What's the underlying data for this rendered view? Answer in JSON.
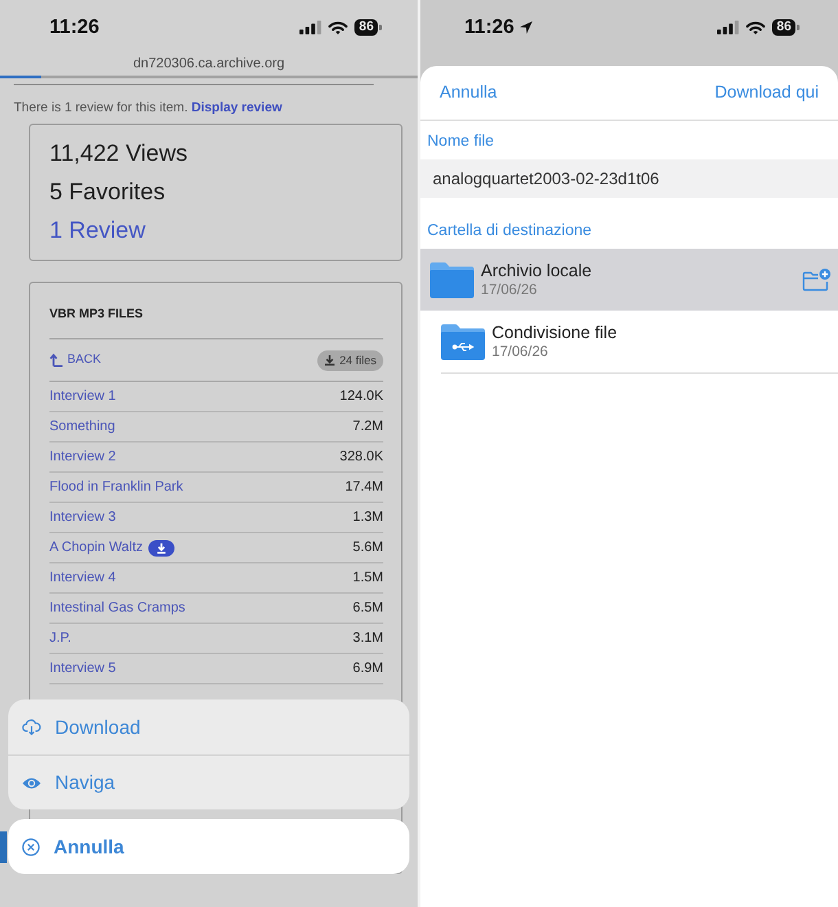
{
  "left_screen": {
    "status_bar": {
      "time": "11:26",
      "location": false,
      "battery": "86"
    },
    "address_bar": {
      "url": "dn720306.ca.archive.org",
      "level": 0.1
    },
    "review_notice": {
      "text": "There is 1 review for this item.",
      "link": "Display review"
    },
    "stats": {
      "views": "11,422 Views",
      "favorites": "5 Favorites",
      "reviews": "1 Review"
    },
    "files": {
      "title": "VBR MP3 FILES",
      "back": "BACK",
      "count": "24 files",
      "rows": [
        {
          "name": "Interview 1",
          "size": "124.0K",
          "download_badge": false
        },
        {
          "name": "Something",
          "size": "7.2M",
          "download_badge": false
        },
        {
          "name": "Interview 2",
          "size": "328.0K",
          "download_badge": false
        },
        {
          "name": "Flood in Franklin Park",
          "size": "17.4M",
          "download_badge": false
        },
        {
          "name": "Interview 3",
          "size": "1.3M",
          "download_badge": false
        },
        {
          "name": "A Chopin Waltz",
          "size": "5.6M",
          "download_badge": true
        },
        {
          "name": "Interview 4",
          "size": "1.5M",
          "download_badge": false
        },
        {
          "name": "Intestinal Gas Cramps",
          "size": "6.5M",
          "download_badge": false
        },
        {
          "name": "J.P.",
          "size": "3.1M",
          "download_badge": false
        },
        {
          "name": "Interview 5",
          "size": "6.9M",
          "download_badge": false
        }
      ]
    },
    "action_sheet": {
      "items": [
        {
          "kind": "download",
          "label": "Download"
        },
        {
          "kind": "browse",
          "label": "Naviga"
        }
      ],
      "cancel": "Annulla"
    }
  },
  "right_screen": {
    "status_bar": {
      "time": "11:26",
      "location": true,
      "battery": "86"
    },
    "sheet": {
      "cancel": "Annulla",
      "confirm": "Download qui",
      "filename_label": "Nome file",
      "filename": "analogquartet2003-02-23d1t06",
      "folder_label": "Cartella di destinazione",
      "folders": [
        {
          "kind": "local",
          "name": "Archivio locale",
          "date": "17/06/26",
          "selected": true
        },
        {
          "kind": "shared",
          "name": "Condivisione file",
          "date": "17/06/26",
          "selected": false
        }
      ]
    }
  }
}
